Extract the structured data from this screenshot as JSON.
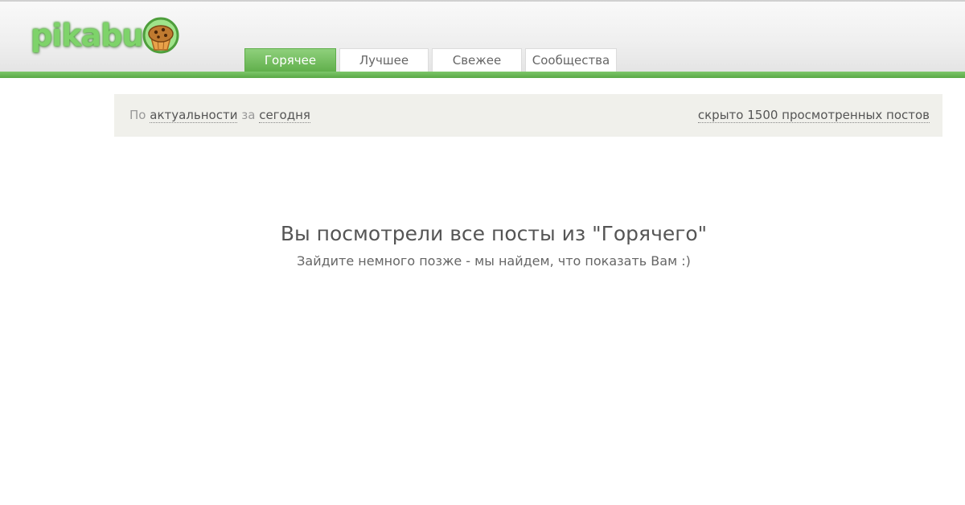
{
  "header": {
    "logo_text": "pikabu",
    "colors": {
      "green": "#5fae4a",
      "logo_green": "#7ed36a"
    }
  },
  "tabs": [
    {
      "label": "Горячее",
      "active": true
    },
    {
      "label": "Лучшее",
      "active": false
    },
    {
      "label": "Свежее",
      "active": false
    },
    {
      "label": "Сообщества",
      "active": false
    }
  ],
  "filter": {
    "prefix": "По",
    "sort_link": "актуальности",
    "middle": "за",
    "period_link": "сегодня",
    "hidden_posts": "скрыто 1500 просмотренных постов"
  },
  "message": {
    "title": "Вы посмотрели все посты из \"Горячего\"",
    "subtitle": "Зайдите немного позже - мы найдем, что показать Вам :)"
  }
}
